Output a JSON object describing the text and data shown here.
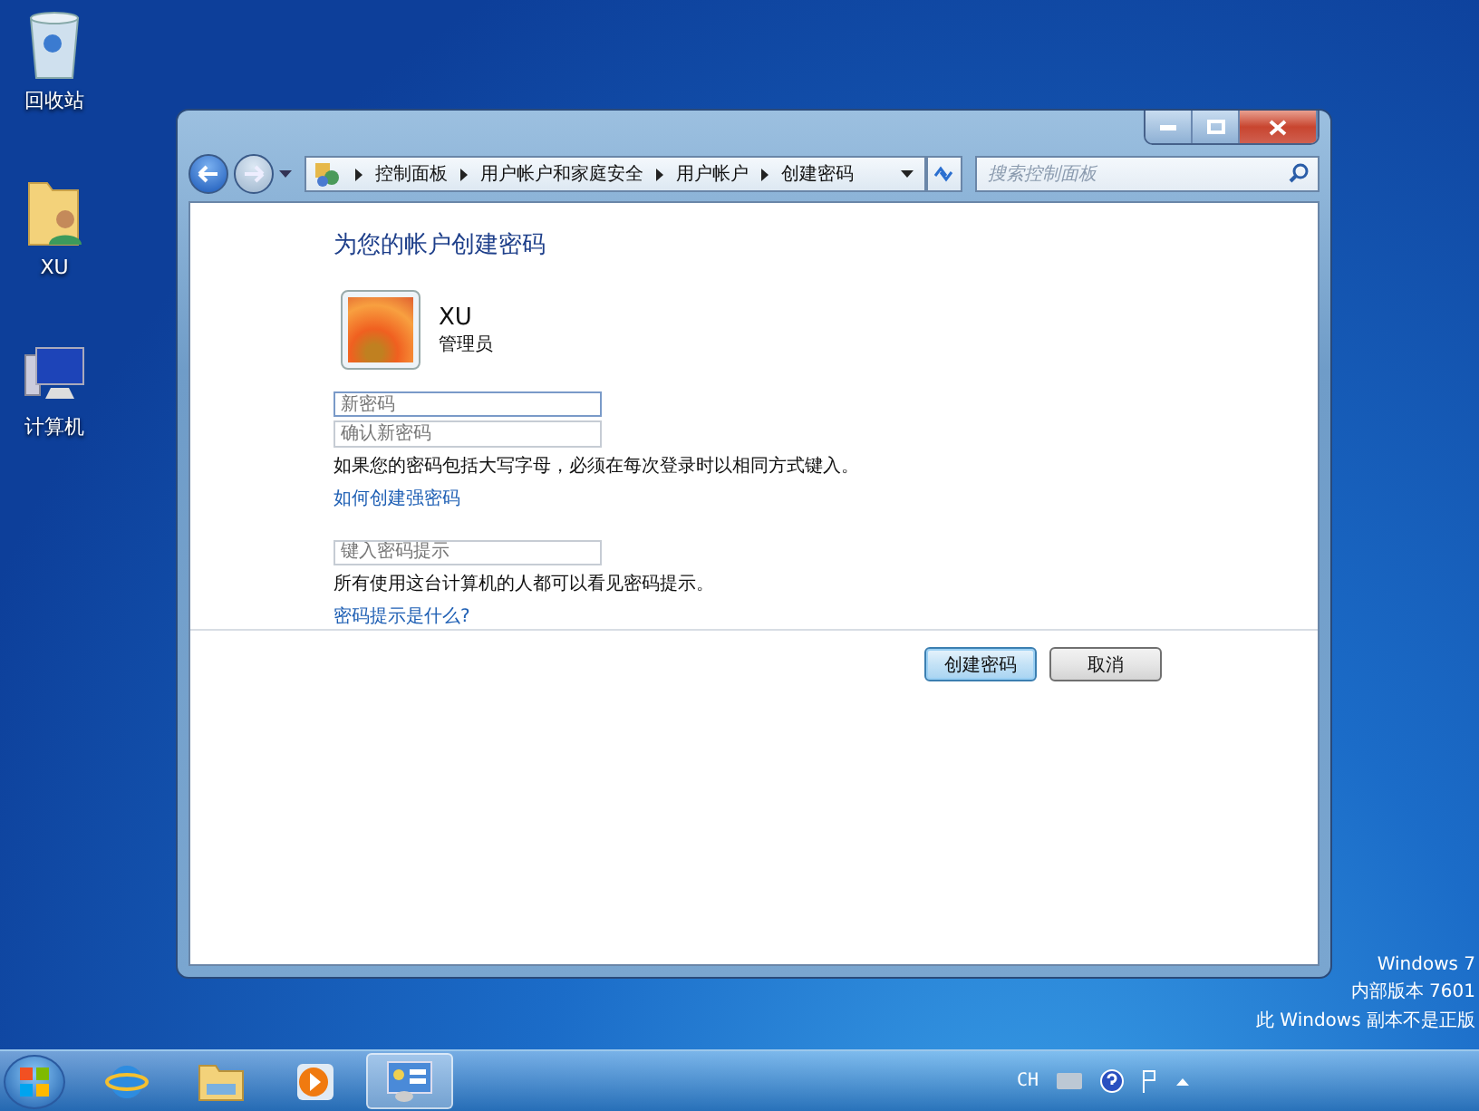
{
  "desktop_icons": [
    {
      "kind": "recycle-bin",
      "label": "回收站"
    },
    {
      "kind": "user-folder",
      "label": "XU"
    },
    {
      "kind": "computer",
      "label": "计算机"
    }
  ],
  "window": {
    "breadcrumb": [
      "控制面板",
      "用户帐户和家庭安全",
      "用户帐户",
      "创建密码"
    ],
    "search": {
      "placeholder": "搜索控制面板"
    },
    "heading": "为您的帐户创建密码",
    "user": {
      "name": "XU",
      "role": "管理员"
    },
    "password_fields": [
      {
        "placeholder": "新密码"
      },
      {
        "placeholder": "确认新密码"
      }
    ],
    "caps_note": "如果您的密码包括大写字母，必须在每次登录时以相同方式键入。",
    "strong_link": "如何创建强密码",
    "hint_field": {
      "placeholder": "键入密码提示"
    },
    "hint_note": "所有使用这台计算机的人都可以看见密码提示。",
    "hint_link": "密码提示是什么?",
    "buttons": [
      {
        "label": "创建密码",
        "default": true
      },
      {
        "label": "取消",
        "default": false
      }
    ]
  },
  "system_notice": [
    "Windows 7",
    "内部版本 7601",
    "此 Windows 副本不是正版"
  ],
  "taskbar": {
    "items": [
      {
        "kind": "ie",
        "selected": false
      },
      {
        "kind": "explorer",
        "selected": false
      },
      {
        "kind": "media-player",
        "selected": false
      },
      {
        "kind": "control-panel",
        "selected": true
      }
    ],
    "language": "CH"
  }
}
